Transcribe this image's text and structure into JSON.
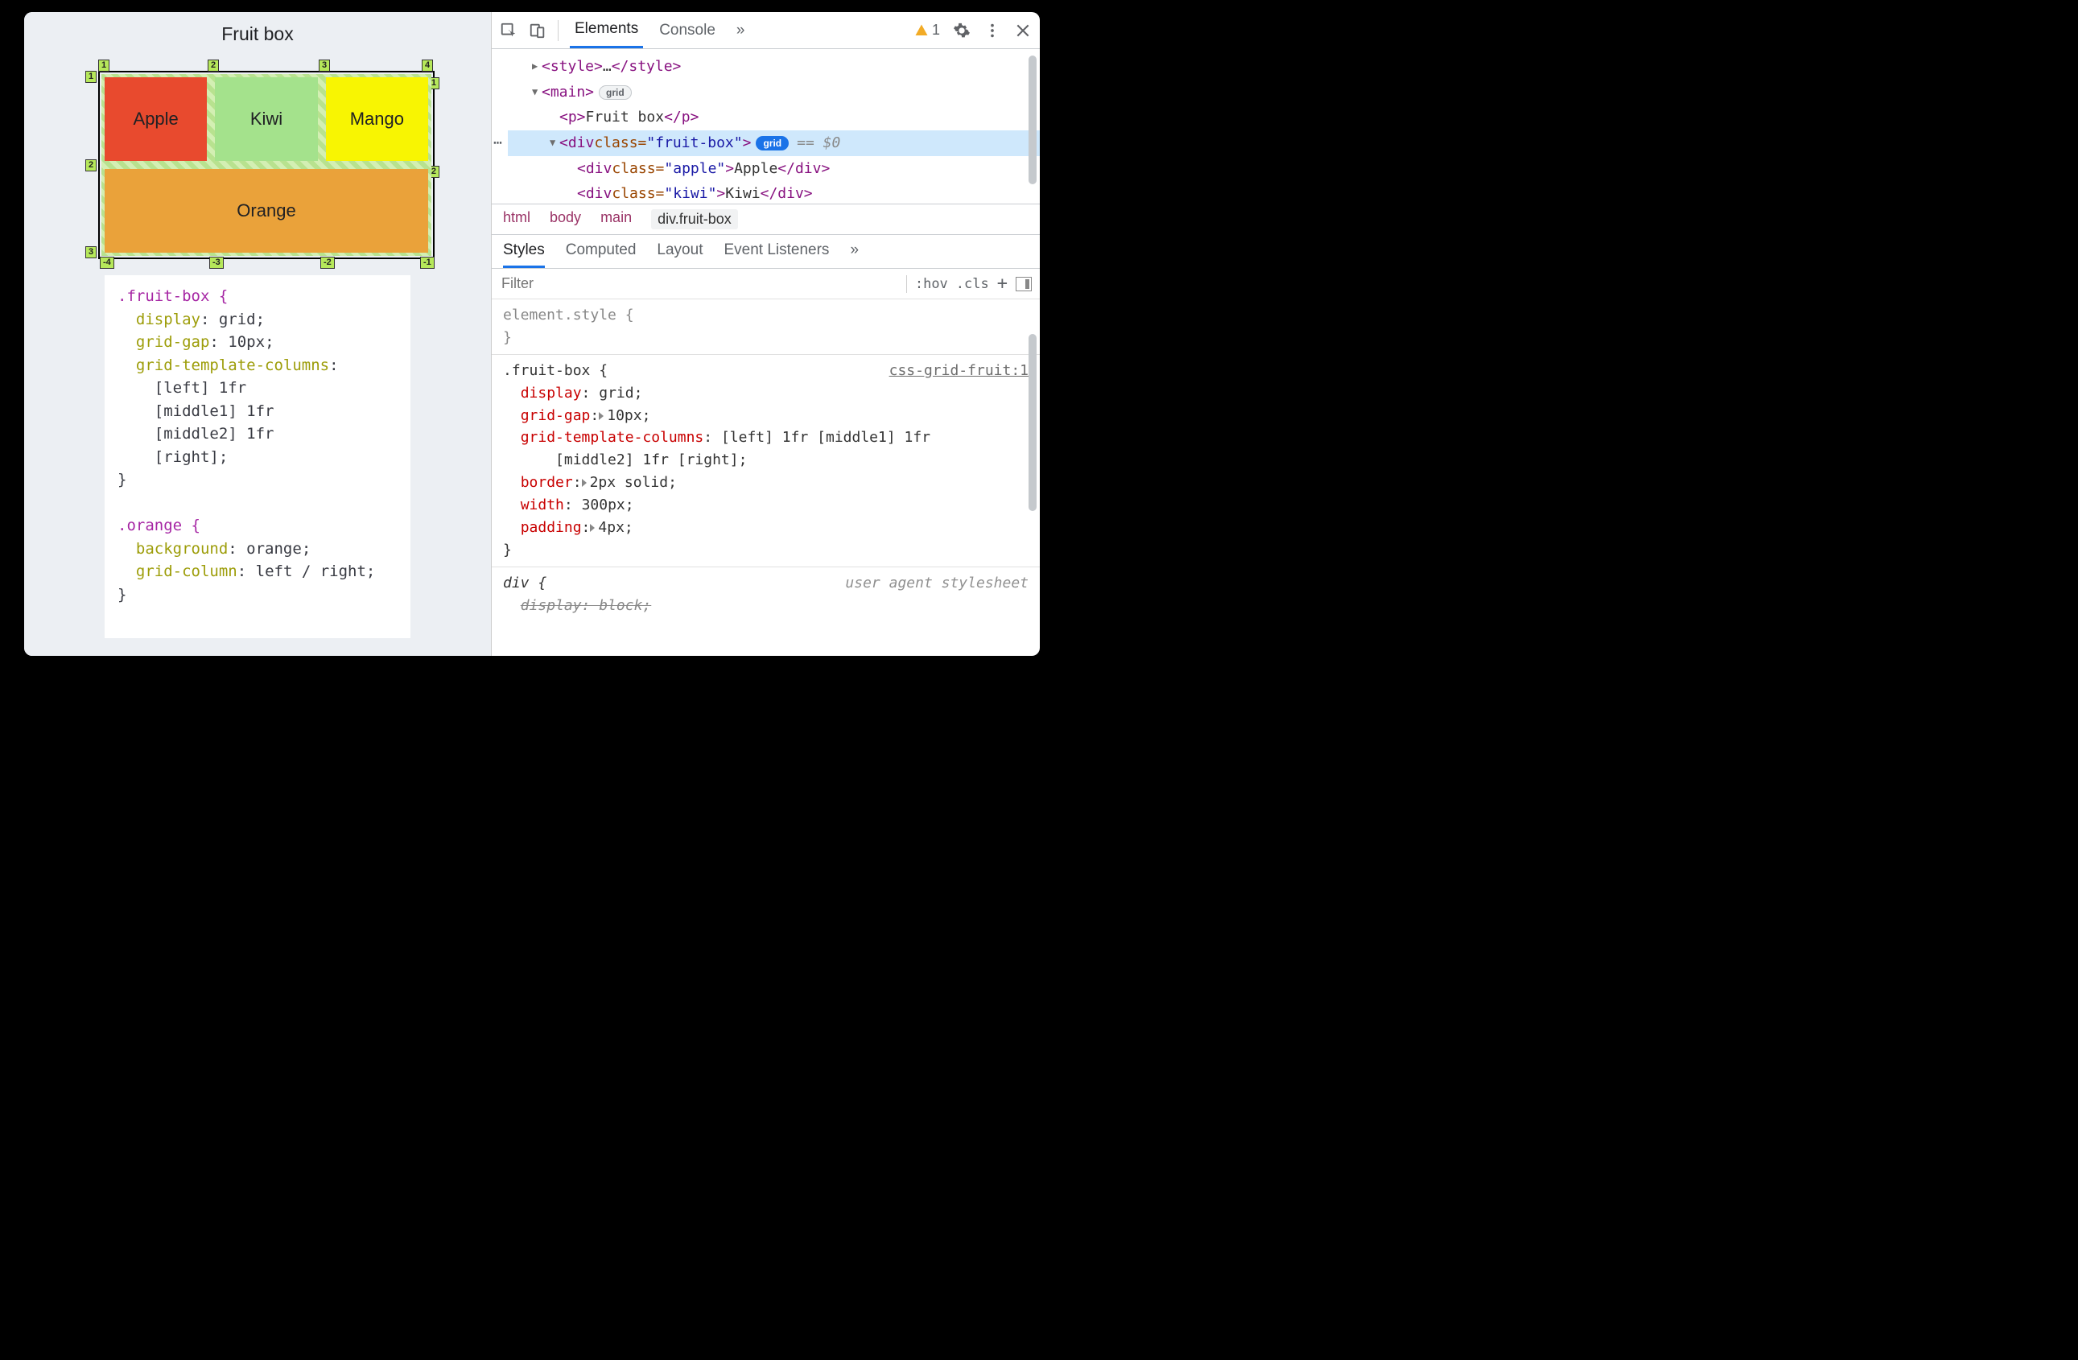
{
  "page": {
    "title": "Fruit box",
    "cells": {
      "apple": "Apple",
      "kiwi": "Kiwi",
      "mango": "Mango",
      "orange": "Orange"
    },
    "gridlines": {
      "top": [
        "1",
        "2",
        "3",
        "4"
      ],
      "left": [
        "1",
        "2",
        "3"
      ],
      "right": [
        "-1",
        "-2"
      ],
      "bottom": [
        "-4",
        "-3",
        "-2",
        "-1"
      ]
    },
    "css": {
      "sel1": ".fruit-box {",
      "l1a": "display",
      "l1b": "grid",
      "l2a": "grid-gap",
      "l2b": "10px",
      "l3a": "grid-template-columns",
      "l4": "[left] 1fr",
      "l5": "[middle1] 1fr",
      "l6": "[middle2] 1fr",
      "l7": "[right]",
      "close1": "}",
      "sel2": ".orange {",
      "l8a": "background",
      "l8b": "orange",
      "l9a": "grid-column",
      "l9b": "left / right",
      "close2": "}"
    }
  },
  "devtools": {
    "tabs": {
      "elements": "Elements",
      "console": "Console",
      "more": "»"
    },
    "warning_count": "1",
    "dom": {
      "style_open": "<style>",
      "style_ell": "…",
      "style_close": "</style>",
      "main_open": "<main>",
      "main_badge": "grid",
      "p_open": "<p>",
      "p_text": "Fruit box",
      "p_close": "</p>",
      "div_open_l": "<div ",
      "div_cls_n": "class=",
      "div_cls_v": "\"fruit-box\"",
      "div_open_r": ">",
      "div_badge": "grid",
      "eq": "== $0",
      "apple_open_l": "<div ",
      "apple_cls_n": "class=",
      "apple_cls_v": "\"apple\"",
      "apple_open_r": ">",
      "apple_txt": "Apple",
      "apple_close": "</div>",
      "kiwi_open_l": "<div ",
      "kiwi_cls_n": "class=",
      "kiwi_cls_v": "\"kiwi\"",
      "kiwi_open_r": ">",
      "kiwi_txt": "Kiwi",
      "kiwi_close": "</div>"
    },
    "crumbs": {
      "a": "html",
      "b": "body",
      "c": "main",
      "d": "div.fruit-box"
    },
    "subtabs": {
      "styles": "Styles",
      "computed": "Computed",
      "layout": "Layout",
      "ev": "Event Listeners",
      "more": "»"
    },
    "filter_placeholder": "Filter",
    "tbtns": {
      "hov": ":hov",
      "cls": ".cls"
    },
    "styles": {
      "elstyle_open": "element.style {",
      "elstyle_close": "}",
      "sel": ".fruit-box {",
      "src": "css-grid-fruit:1",
      "p1n": "display",
      "p1v": "grid",
      "p2n": "grid-gap",
      "p2v": "10px",
      "p3n": "grid-template-columns",
      "p3v": "[left] 1fr [middle1] 1fr",
      "p3v2": "[middle2] 1fr [right]",
      "p4n": "border",
      "p4v": "2px solid",
      "p5n": "width",
      "p5v": "300px",
      "p6n": "padding",
      "p6v": "4px",
      "close": "}",
      "ua_sel": "div {",
      "ua_src": "user agent stylesheet",
      "ua_p": "display: block;"
    }
  }
}
